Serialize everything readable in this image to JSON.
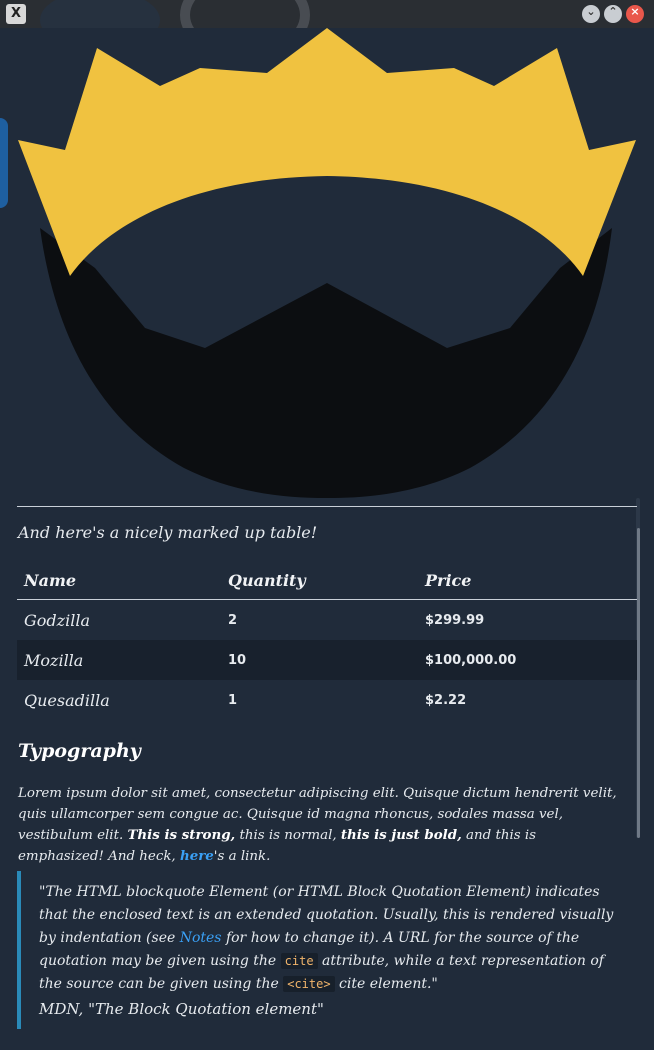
{
  "window": {
    "app_icon": "X",
    "minimize_icon": "chevron-down-icon",
    "maximize_icon": "chevron-up-icon",
    "close_icon": "close-icon"
  },
  "colors": {
    "crown": "#f0c240",
    "mask": "#0d0f12",
    "link": "#3aa0f5",
    "quote_border": "#2a8ab8",
    "code_text": "#f0b46b"
  },
  "intro_text": "And here's a nicely marked up table!",
  "table": {
    "headers": [
      "Name",
      "Quantity",
      "Price"
    ],
    "rows": [
      [
        "Godzilla",
        "2",
        "$299.99"
      ],
      [
        "Mozilla",
        "10",
        "$100,000.00"
      ],
      [
        "Quesadilla",
        "1",
        "$2.22"
      ]
    ]
  },
  "typography": {
    "heading": "Typography",
    "p1": "Lorem ipsum dolor sit amet, consectetur adipiscing elit. Quisque dictum hendrerit velit, quis ullamcorper sem congue ac. Quisque id magna rhoncus, sodales massa vel, vestibulum elit. ",
    "strong": "This is strong,",
    "normal": " this is normal, ",
    "bold": "this is just bold,",
    "em": " and this is emphasized! And heck, ",
    "link": "here",
    "tail": "'s a link."
  },
  "quote": {
    "t1": "\"The HTML blockquote Element (or HTML Block Quotation Element) indicates that the enclosed text is an extended quotation. Usually, this is rendered visually by indentation (see ",
    "link": "Notes",
    "t2": " for how to change it). A URL for the source of the quotation may be given using the ",
    "code1": "cite",
    "t3": " attribute, while a text representation of the source can be given using the ",
    "code2": "<cite>",
    "t4": " cite element.\"",
    "cite": "MDN, \"The Block Quotation element\""
  }
}
